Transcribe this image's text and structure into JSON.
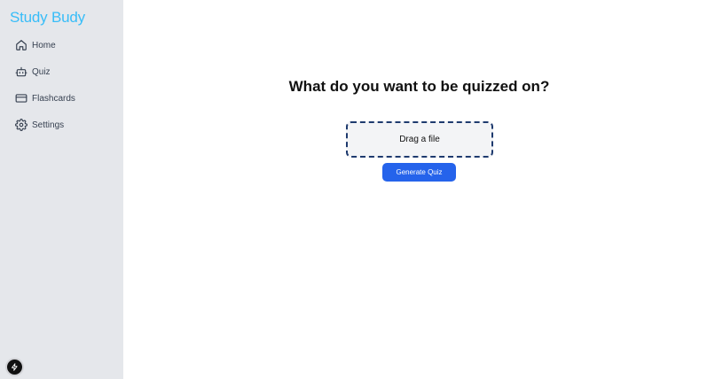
{
  "sidebar": {
    "brand": "Study Budy",
    "items": [
      {
        "label": "Home",
        "icon": "home-icon"
      },
      {
        "label": "Quiz",
        "icon": "robot-icon"
      },
      {
        "label": "Flashcards",
        "icon": "card-icon"
      },
      {
        "label": "Settings",
        "icon": "gear-icon"
      }
    ]
  },
  "main": {
    "heading": "What do you want to be quizzed on?",
    "dropzone_label": "Drag a file",
    "generate_label": "Generate Quiz"
  },
  "colors": {
    "brand": "#38bdf8",
    "sidebar_bg": "#e5e7eb",
    "primary": "#2563eb",
    "dropzone_border": "#1e3a6e"
  }
}
